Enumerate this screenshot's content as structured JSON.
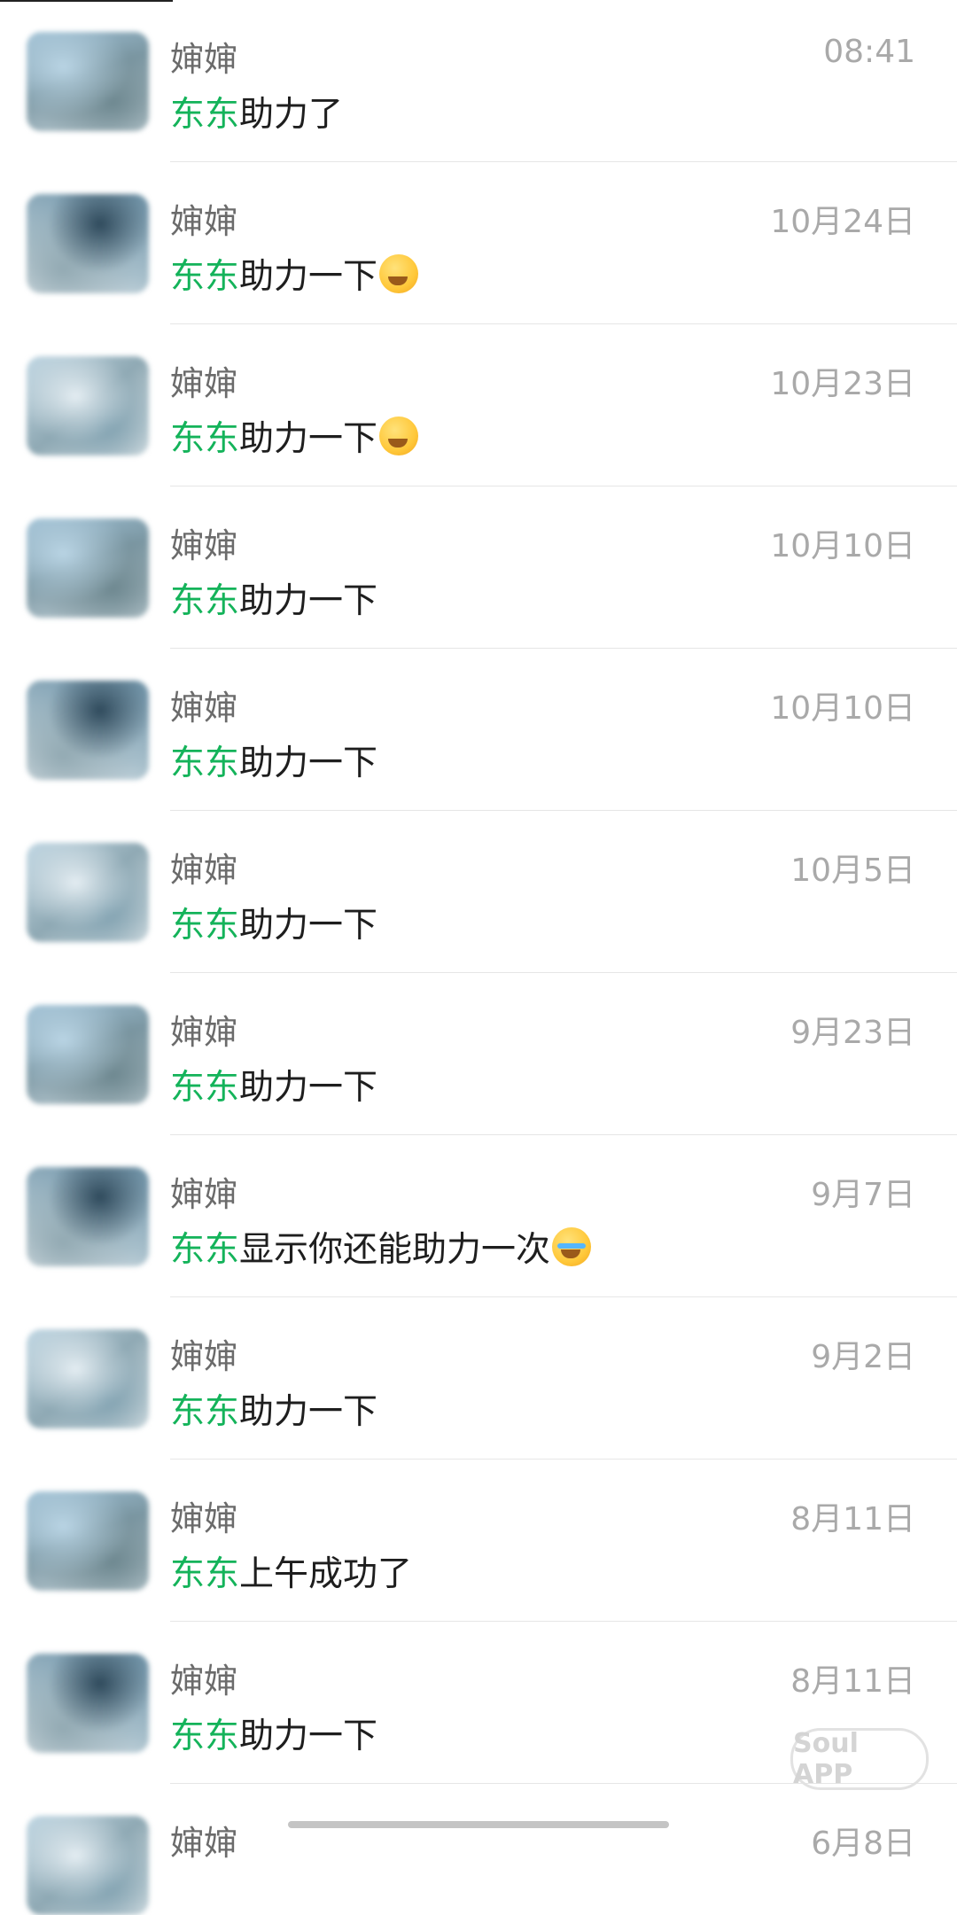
{
  "chats": [
    {
      "name": "婶婶",
      "time": "08:41",
      "sender": "东东",
      "text": "助力了",
      "emoji": ""
    },
    {
      "name": "婶婶",
      "time": "10月24日",
      "sender": "东东",
      "text": "助力一下",
      "emoji": "thinking-face"
    },
    {
      "name": "婶婶",
      "time": "10月23日",
      "sender": "东东",
      "text": "助力一下",
      "emoji": "thinking-face"
    },
    {
      "name": "婶婶",
      "time": "10月10日",
      "sender": "东东",
      "text": "助力一下",
      "emoji": ""
    },
    {
      "name": "婶婶",
      "time": "10月10日",
      "sender": "东东",
      "text": "助力一下",
      "emoji": ""
    },
    {
      "name": "婶婶",
      "time": "10月5日",
      "sender": "东东",
      "text": "助力一下",
      "emoji": ""
    },
    {
      "name": "婶婶",
      "time": "9月23日",
      "sender": "东东",
      "text": "助力一下",
      "emoji": ""
    },
    {
      "name": "婶婶",
      "time": "9月7日",
      "sender": "东东",
      "text": "显示你还能助力一次",
      "emoji": "crying-laughing-face"
    },
    {
      "name": "婶婶",
      "time": "9月2日",
      "sender": "东东",
      "text": "助力一下",
      "emoji": ""
    },
    {
      "name": "婶婶",
      "time": "8月11日",
      "sender": "东东",
      "text": "上午成功了",
      "emoji": ""
    },
    {
      "name": "婶婶",
      "time": "8月11日",
      "sender": "东东",
      "text": "助力一下",
      "emoji": ""
    }
  ],
  "partial": {
    "name": "婶婶",
    "time": "6月8日"
  },
  "watermark": "Soul APP",
  "colors": {
    "sender": "#14b35a",
    "time": "#a9a9a9",
    "name": "#6b6b6b"
  }
}
